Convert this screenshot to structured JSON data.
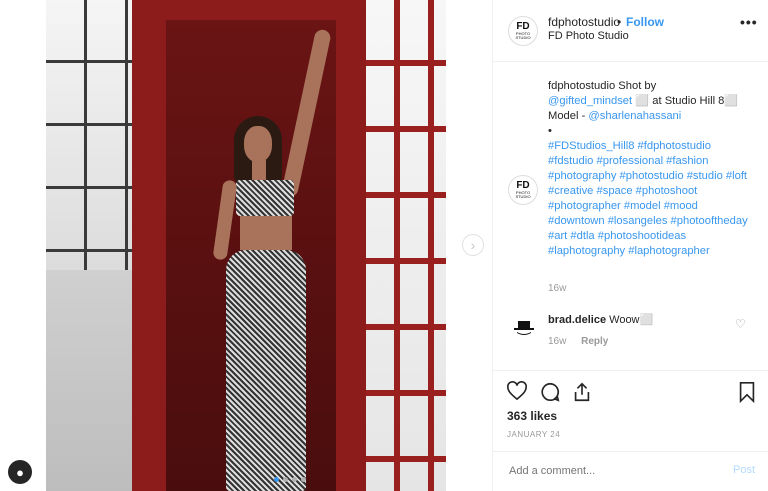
{
  "post": {
    "username": "fdphotostudio",
    "follow_label": "Follow",
    "subtitle": "FD Photo Studio",
    "more_label": "•••",
    "avatar_text": "FD",
    "avatar_subtext": "PHOTO STUDIO"
  },
  "caption": {
    "username": "fdphotostudio",
    "text_1": "Shot by",
    "mention_1": "@gifted_mindset",
    "text_2": "⬜ at Studio Hill 8⬜ Model -",
    "mention_2": "@sharlenahassani",
    "bullet": "•",
    "hashtags": "#FDStudios_Hill8 #fdphotostudio #fdstudio #professional #fashion #photography #photostudio #studio #loft #creative #space #photoshoot #photographer #model #mood #downtown #losangeles #photooftheday #art #dtla #photoshootideas #laphotography #laphotographer",
    "time": "16w"
  },
  "comment": {
    "username": "brad.delice",
    "text": "Woow⬜",
    "time": "16w",
    "reply_label": "Reply"
  },
  "stats": {
    "likes": "363 likes",
    "date": "JANUARY 24"
  },
  "compose": {
    "placeholder": "Add a comment...",
    "post_label": "Post"
  },
  "icons": {
    "heart": "heart-icon",
    "comment": "comment-icon",
    "share": "share-icon",
    "save": "bookmark-icon"
  },
  "colors": {
    "link": "#3897f0",
    "text": "#262626",
    "muted": "#999999"
  }
}
